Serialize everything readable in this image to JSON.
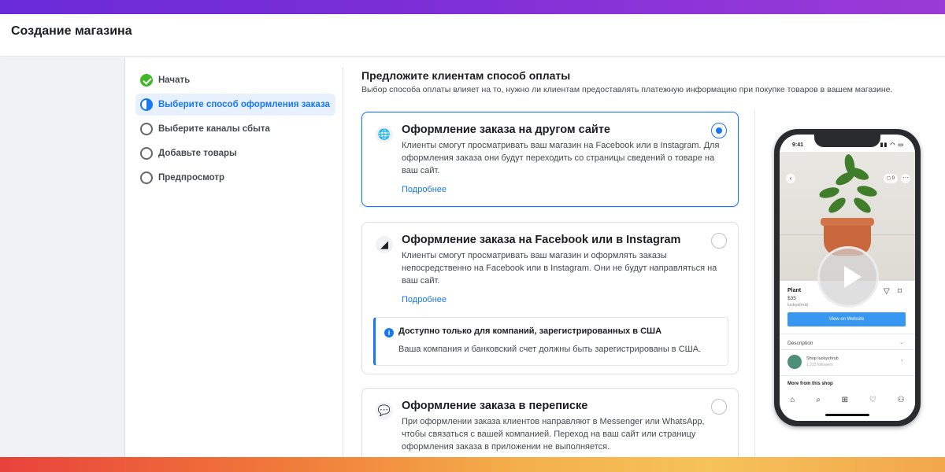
{
  "header": {
    "title": "Создание магазина"
  },
  "steps": [
    {
      "label": "Начать",
      "state": "done"
    },
    {
      "label": "Выберите способ оформления заказа",
      "state": "active"
    },
    {
      "label": "Выберите каналы сбыта",
      "state": "pending"
    },
    {
      "label": "Добавьте товары",
      "state": "pending"
    },
    {
      "label": "Предпросмотр",
      "state": "pending"
    }
  ],
  "section": {
    "title": "Предложите клиентам способ оплаты",
    "subtitle": "Выбор способа оплаты влияет на то, нужно ли клиентам предоставлять платежную информацию при покупке товаров в вашем магазине."
  },
  "options": [
    {
      "icon": "globe-icon",
      "title": "Оформление заказа на другом сайте",
      "description": "Клиенты смогут просматривать ваш магазин на Facebook или в Instagram. Для оформления заказа они будут переходить со страницы сведений о товаре на ваш сайт.",
      "more": "Подробнее",
      "selected": true
    },
    {
      "icon": "card-icon",
      "title": "Оформление заказа на Facebook или в Instagram",
      "description": "Клиенты смогут просматривать ваш магазин и оформлять заказы непосредственно на Facebook или в Instagram. Они не будут направляться на ваш сайт.",
      "more": "Подробнее",
      "selected": false,
      "notice": {
        "title": "Доступно только для компаний, зарегистрированных в США",
        "text": "Ваша компания и банковский счет должны быть зарегистрированы в США."
      }
    },
    {
      "icon": "chat-icon",
      "title": "Оформление заказа в переписке",
      "description": "При оформлении заказа клиентов направляют в Messenger или WhatsApp, чтобы связаться с вашей компанией. Переход на ваш сайт или страницу оформления заказа в приложении не выполняется.",
      "selected": false
    }
  ],
  "preview": {
    "time": "9:41",
    "signal": "▮▮ ◠ ▭",
    "back_glyph": "‹",
    "cart_glyph": "◻ 0",
    "menu_glyph": "···",
    "product_name": "Plant",
    "product_price": "$35",
    "product_shop": "luckyshrub",
    "share_glyph": "▽",
    "save_glyph": "⌑",
    "button": "View on Website",
    "description_label": "Description",
    "chevron_down": "⌄",
    "chevron_right": "›",
    "shop_name": "Shop luckyshrub",
    "shop_followers": "1,233 followers",
    "more_label": "More from this shop",
    "nav": [
      "⌂",
      "⌕",
      "⊞",
      "♡",
      "⚇"
    ]
  },
  "colors": {
    "accent": "#1877f2",
    "success": "#42b72a"
  }
}
